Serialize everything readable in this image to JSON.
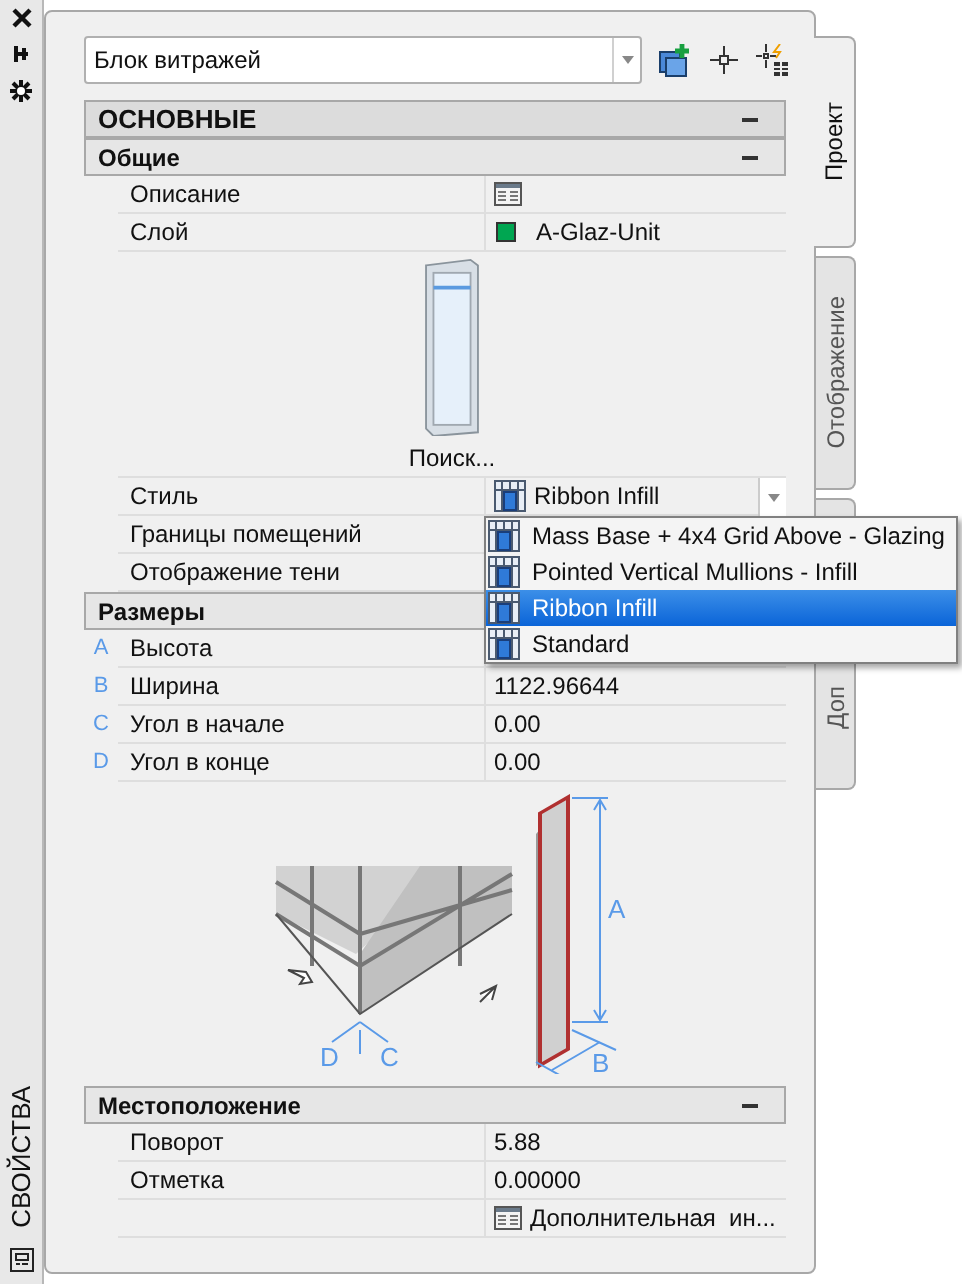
{
  "side_strip": {
    "title": "СВОЙСТВА"
  },
  "selector": {
    "value": "Блок витражей"
  },
  "tabs": [
    {
      "label": "Проект",
      "selected": true
    },
    {
      "label": "Отображение",
      "selected": false
    },
    {
      "label": "Доп",
      "selected": false
    }
  ],
  "rows": [
    {
      "kind": "category",
      "title": "ОСНОВНЫЕ",
      "expanded": true
    },
    {
      "kind": "group",
      "title": "Общие",
      "expanded": true
    },
    {
      "kind": "property",
      "label": "Описание",
      "editor_icon": true
    },
    {
      "kind": "property",
      "label": "Слой",
      "value": "A-Glaz-Unit",
      "color": "#00a651"
    },
    {
      "kind": "preview",
      "caption": "Поиск..."
    },
    {
      "kind": "property",
      "label": "Стиль",
      "value": "Ribbon Infill",
      "style_icon": true,
      "open": true
    },
    {
      "kind": "property",
      "label": "Границы помещений"
    },
    {
      "kind": "property",
      "label": "Отображение тени"
    },
    {
      "kind": "group",
      "title": "Размеры"
    },
    {
      "kind": "property",
      "letter": "A",
      "label": "Высота"
    },
    {
      "kind": "property",
      "letter": "B",
      "label": "Ширина",
      "value": "1122.96644"
    },
    {
      "kind": "property",
      "letter": "C",
      "label": "Угол в начале",
      "value": "0.00"
    },
    {
      "kind": "property",
      "letter": "D",
      "label": "Угол в конце",
      "value": "0.00"
    },
    {
      "kind": "diagram",
      "labels": [
        "A",
        "D",
        "C",
        "B"
      ]
    },
    {
      "kind": "group",
      "title": "Местоположение",
      "expanded": true
    },
    {
      "kind": "property",
      "label": "Поворот",
      "value": "5.88"
    },
    {
      "kind": "property",
      "label": "Отметка",
      "value": "0.00000"
    },
    {
      "kind": "property",
      "value": "Дополнительная  ин...",
      "editor_icon": true
    }
  ],
  "dropdown": {
    "options": [
      {
        "label": "Mass Base + 4x4 Grid Above - Glazing",
        "selected": false
      },
      {
        "label": "Pointed Vertical Mullions - Infill",
        "selected": false
      },
      {
        "label": "Ribbon Infill",
        "selected": true
      },
      {
        "label": "Standard",
        "selected": false
      }
    ]
  }
}
